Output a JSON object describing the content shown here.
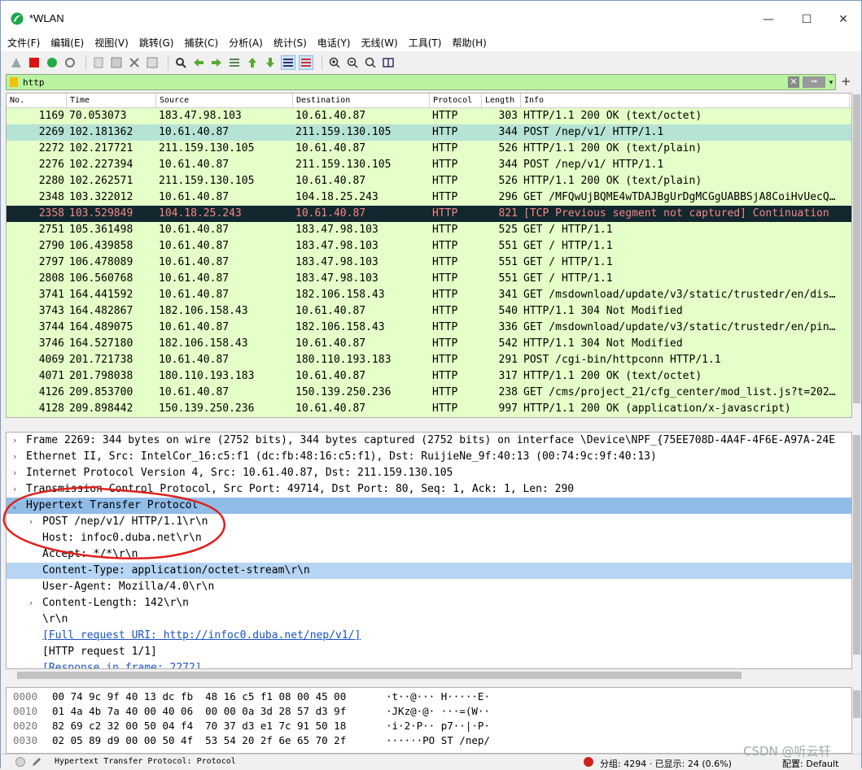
{
  "window": {
    "title": "*WLAN",
    "min": "—",
    "max": "☐",
    "close": "✕"
  },
  "menu": [
    "文件(F)",
    "编辑(E)",
    "视图(V)",
    "跳转(G)",
    "捕获(C)",
    "分析(A)",
    "统计(S)",
    "电话(Y)",
    "无线(W)",
    "工具(T)",
    "帮助(H)"
  ],
  "filter": {
    "value": "http",
    "clear": "✕",
    "apply": "⇒",
    "dropdown": "▾",
    "add": "+"
  },
  "columns": {
    "no": "No.",
    "time": "Time",
    "src": "Source",
    "dst": "Destination",
    "proto": "Protocol",
    "len": "Length",
    "info": "Info"
  },
  "packets": [
    {
      "no": "1169",
      "time": "70.053073",
      "src": "183.47.98.103",
      "dst": "10.61.40.87",
      "proto": "HTTP",
      "len": "303",
      "info": "HTTP/1.1 200 OK  (text/octet)"
    },
    {
      "no": "2269",
      "time": "102.181362",
      "src": "10.61.40.87",
      "dst": "211.159.130.105",
      "proto": "HTTP",
      "len": "344",
      "info": "POST /nep/v1/ HTTP/1.1"
    },
    {
      "no": "2272",
      "time": "102.217721",
      "src": "211.159.130.105",
      "dst": "10.61.40.87",
      "proto": "HTTP",
      "len": "526",
      "info": "HTTP/1.1 200 OK  (text/plain)"
    },
    {
      "no": "2276",
      "time": "102.227394",
      "src": "10.61.40.87",
      "dst": "211.159.130.105",
      "proto": "HTTP",
      "len": "344",
      "info": "POST /nep/v1/ HTTP/1.1"
    },
    {
      "no": "2280",
      "time": "102.262571",
      "src": "211.159.130.105",
      "dst": "10.61.40.87",
      "proto": "HTTP",
      "len": "526",
      "info": "HTTP/1.1 200 OK  (text/plain)"
    },
    {
      "no": "2348",
      "time": "103.322012",
      "src": "10.61.40.87",
      "dst": "104.18.25.243",
      "proto": "HTTP",
      "len": "296",
      "info": "GET /MFQwUjBQME4wTDAJBgUrDgMCGgUABBSjA8CoiHvUecQ…"
    },
    {
      "no": "2358",
      "time": "103.529849",
      "src": "104.18.25.243",
      "dst": "10.61.40.87",
      "proto": "HTTP",
      "len": "821",
      "info": "[TCP Previous segment not captured] Continuation"
    },
    {
      "no": "2751",
      "time": "105.361498",
      "src": "10.61.40.87",
      "dst": "183.47.98.103",
      "proto": "HTTP",
      "len": "525",
      "info": "GET / HTTP/1.1"
    },
    {
      "no": "2790",
      "time": "106.439858",
      "src": "10.61.40.87",
      "dst": "183.47.98.103",
      "proto": "HTTP",
      "len": "551",
      "info": "GET / HTTP/1.1"
    },
    {
      "no": "2797",
      "time": "106.478089",
      "src": "10.61.40.87",
      "dst": "183.47.98.103",
      "proto": "HTTP",
      "len": "551",
      "info": "GET / HTTP/1.1"
    },
    {
      "no": "2808",
      "time": "106.560768",
      "src": "10.61.40.87",
      "dst": "183.47.98.103",
      "proto": "HTTP",
      "len": "551",
      "info": "GET / HTTP/1.1"
    },
    {
      "no": "3741",
      "time": "164.441592",
      "src": "10.61.40.87",
      "dst": "182.106.158.43",
      "proto": "HTTP",
      "len": "341",
      "info": "GET /msdownload/update/v3/static/trustedr/en/dis…"
    },
    {
      "no": "3743",
      "time": "164.482867",
      "src": "182.106.158.43",
      "dst": "10.61.40.87",
      "proto": "HTTP",
      "len": "540",
      "info": "HTTP/1.1 304 Not Modified"
    },
    {
      "no": "3744",
      "time": "164.489075",
      "src": "10.61.40.87",
      "dst": "182.106.158.43",
      "proto": "HTTP",
      "len": "336",
      "info": "GET /msdownload/update/v3/static/trustedr/en/pin…"
    },
    {
      "no": "3746",
      "time": "164.527180",
      "src": "182.106.158.43",
      "dst": "10.61.40.87",
      "proto": "HTTP",
      "len": "542",
      "info": "HTTP/1.1 304 Not Modified"
    },
    {
      "no": "4069",
      "time": "201.721738",
      "src": "10.61.40.87",
      "dst": "180.110.193.183",
      "proto": "HTTP",
      "len": "291",
      "info": "POST /cgi-bin/httpconn HTTP/1.1"
    },
    {
      "no": "4071",
      "time": "201.798038",
      "src": "180.110.193.183",
      "dst": "10.61.40.87",
      "proto": "HTTP",
      "len": "317",
      "info": "HTTP/1.1 200 OK  (text/octet)"
    },
    {
      "no": "4126",
      "time": "209.853700",
      "src": "10.61.40.87",
      "dst": "150.139.250.236",
      "proto": "HTTP",
      "len": "238",
      "info": "GET /cms/project_21/cfg_center/mod_list.js?t=202…"
    },
    {
      "no": "4128",
      "time": "209.898442",
      "src": "150.139.250.236",
      "dst": "10.61.40.87",
      "proto": "HTTP",
      "len": "997",
      "info": "HTTP/1.1 200 OK  (application/x-javascript)"
    }
  ],
  "details": [
    {
      "text": "Frame 2269: 344 bytes on wire (2752 bits), 344 bytes captured (2752 bits) on interface \\Device\\NPF_{75EE708D-4A4F-4F6E-A97A-24E",
      "exp": "›",
      "lvl": 0
    },
    {
      "text": "Ethernet II, Src: IntelCor_16:c5:f1 (dc:fb:48:16:c5:f1), Dst: RuijieNe_9f:40:13 (00:74:9c:9f:40:13)",
      "exp": "›",
      "lvl": 0
    },
    {
      "text": "Internet Protocol Version 4, Src: 10.61.40.87, Dst: 211.159.130.105",
      "exp": "›",
      "lvl": 0
    },
    {
      "text": "Transmission Control Protocol, Src Port: 49714, Dst Port: 80, Seq: 1, Ack: 1, Len: 290",
      "exp": "›",
      "lvl": 0
    },
    {
      "text": "Hypertext Transfer Protocol",
      "exp": "⌄",
      "lvl": 0
    },
    {
      "text": "POST /nep/v1/ HTTP/1.1\\r\\n",
      "exp": "›",
      "lvl": 1
    },
    {
      "text": "Host: infoc0.duba.net\\r\\n",
      "exp": "",
      "lvl": 1
    },
    {
      "text": "Accept: */*\\r\\n",
      "exp": "",
      "lvl": 1
    },
    {
      "text": "Content-Type: application/octet-stream\\r\\n",
      "exp": "",
      "lvl": 1
    },
    {
      "text": "User-Agent: Mozilla/4.0\\r\\n",
      "exp": "",
      "lvl": 1
    },
    {
      "text": "Content-Length: 142\\r\\n",
      "exp": "›",
      "lvl": 1
    },
    {
      "text": "\\r\\n",
      "exp": "",
      "lvl": 1
    },
    {
      "text": "[Full request URI: http://infoc0.duba.net/nep/v1/]",
      "exp": "",
      "lvl": 1
    },
    {
      "text": "[HTTP request 1/1]",
      "exp": "",
      "lvl": 1
    },
    {
      "text": "[Response in frame: 2272]",
      "exp": "",
      "lvl": 1
    }
  ],
  "bytes": [
    {
      "off": "0000",
      "hex": "00 74 9c 9f 40 13 dc fb  48 16 c5 f1 08 00 45 00",
      "ascii": "·t··@··· H·····E·"
    },
    {
      "off": "0010",
      "hex": "01 4a 4b 7a 40 00 40 06  00 00 0a 3d 28 57 d3 9f",
      "ascii": "·JKz@·@· ···=(W··"
    },
    {
      "off": "0020",
      "hex": "82 69 c2 32 00 50 04 f4  70 37 d3 e1 7c 91 50 18",
      "ascii": "·i·2·P·· p7··|·P·"
    },
    {
      "off": "0030",
      "hex": "02 05 89 d9 00 00 50 4f  53 54 20 2f 6e 65 70 2f",
      "ascii": "······PO ST /nep/"
    }
  ],
  "status": {
    "text": "Hypertext Transfer Protocol: Protocol",
    "stats": "分组: 4294 · 已显示: 24 (0.6%)",
    "profile": "配置: Default"
  },
  "watermark": "CSDN @听云轩",
  "colors": {
    "accent": "#b5e3d6",
    "http_row": "#e4ffc7",
    "bad_row": "#12272e",
    "filter_ok": "#b9f3a0",
    "annotation": "#e0201c"
  }
}
